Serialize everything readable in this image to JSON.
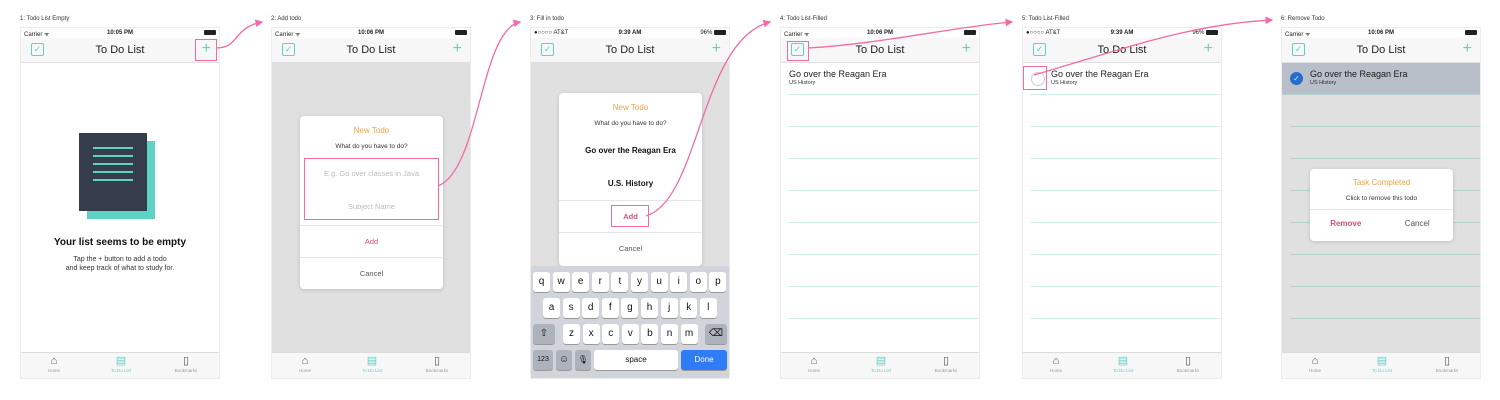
{
  "captions": [
    "1: Todo List Empty",
    "2: Add todo",
    "3: Fill in todo",
    "4: Todo List-Filled",
    "5: Todo List-Filled",
    "6: Remove Todo"
  ],
  "status": {
    "carrier": "Carrier",
    "carrier_att": "●○○○○ AT&T",
    "wifi": "ᯤ",
    "time_1005": "10:05 PM",
    "time_1006": "10:06 PM",
    "time_939": "9:39 AM",
    "battery_pct": "96%"
  },
  "nav": {
    "title": "To Do List",
    "plus": "+",
    "check": "✓"
  },
  "tabs": [
    {
      "label": "Home",
      "icon": "house-icon",
      "glyph": "⌂"
    },
    {
      "label": "To Do List",
      "icon": "todo-doc-icon",
      "glyph": "▤"
    },
    {
      "label": "Bookmarks",
      "icon": "bookmark-icon",
      "glyph": "▯"
    }
  ],
  "empty": {
    "heading": "Your list seems to be empty",
    "line1": "Tap the + button to add a todo",
    "line2": "and keep track of what to study for."
  },
  "new_todo": {
    "title": "New Todo",
    "subtitle": "What do you have to do?",
    "task_placeholder": "E.g. Go over classes in Java",
    "subject_placeholder": "Subject Name",
    "task_value": "Go over the Reagan Era",
    "subject_value": "U.S. History",
    "add": "Add",
    "cancel": "Cancel"
  },
  "todo_item": {
    "title": "Go over the Reagan Era",
    "subject": "US History"
  },
  "completed": {
    "title": "Task Completed",
    "subtitle": "Click to remove this todo",
    "remove": "Remove",
    "cancel": "Cancel"
  },
  "keyboard": {
    "row1": [
      "q",
      "w",
      "e",
      "r",
      "t",
      "y",
      "u",
      "i",
      "o",
      "p"
    ],
    "row2": [
      "a",
      "s",
      "d",
      "f",
      "g",
      "h",
      "j",
      "k",
      "l"
    ],
    "row3": [
      "z",
      "x",
      "c",
      "v",
      "b",
      "n",
      "m"
    ],
    "shift": "⇧",
    "del": "⌫",
    "num": "123",
    "emoji": "☺",
    "mic": "🎙",
    "space": "space",
    "done": "Done"
  },
  "colors": {
    "accent": "#5ed3c3",
    "highlight": "#f06ca4",
    "dialog_title": "#e8a34a",
    "danger": "#d94f7c",
    "selected_row": "#d3dae5"
  }
}
